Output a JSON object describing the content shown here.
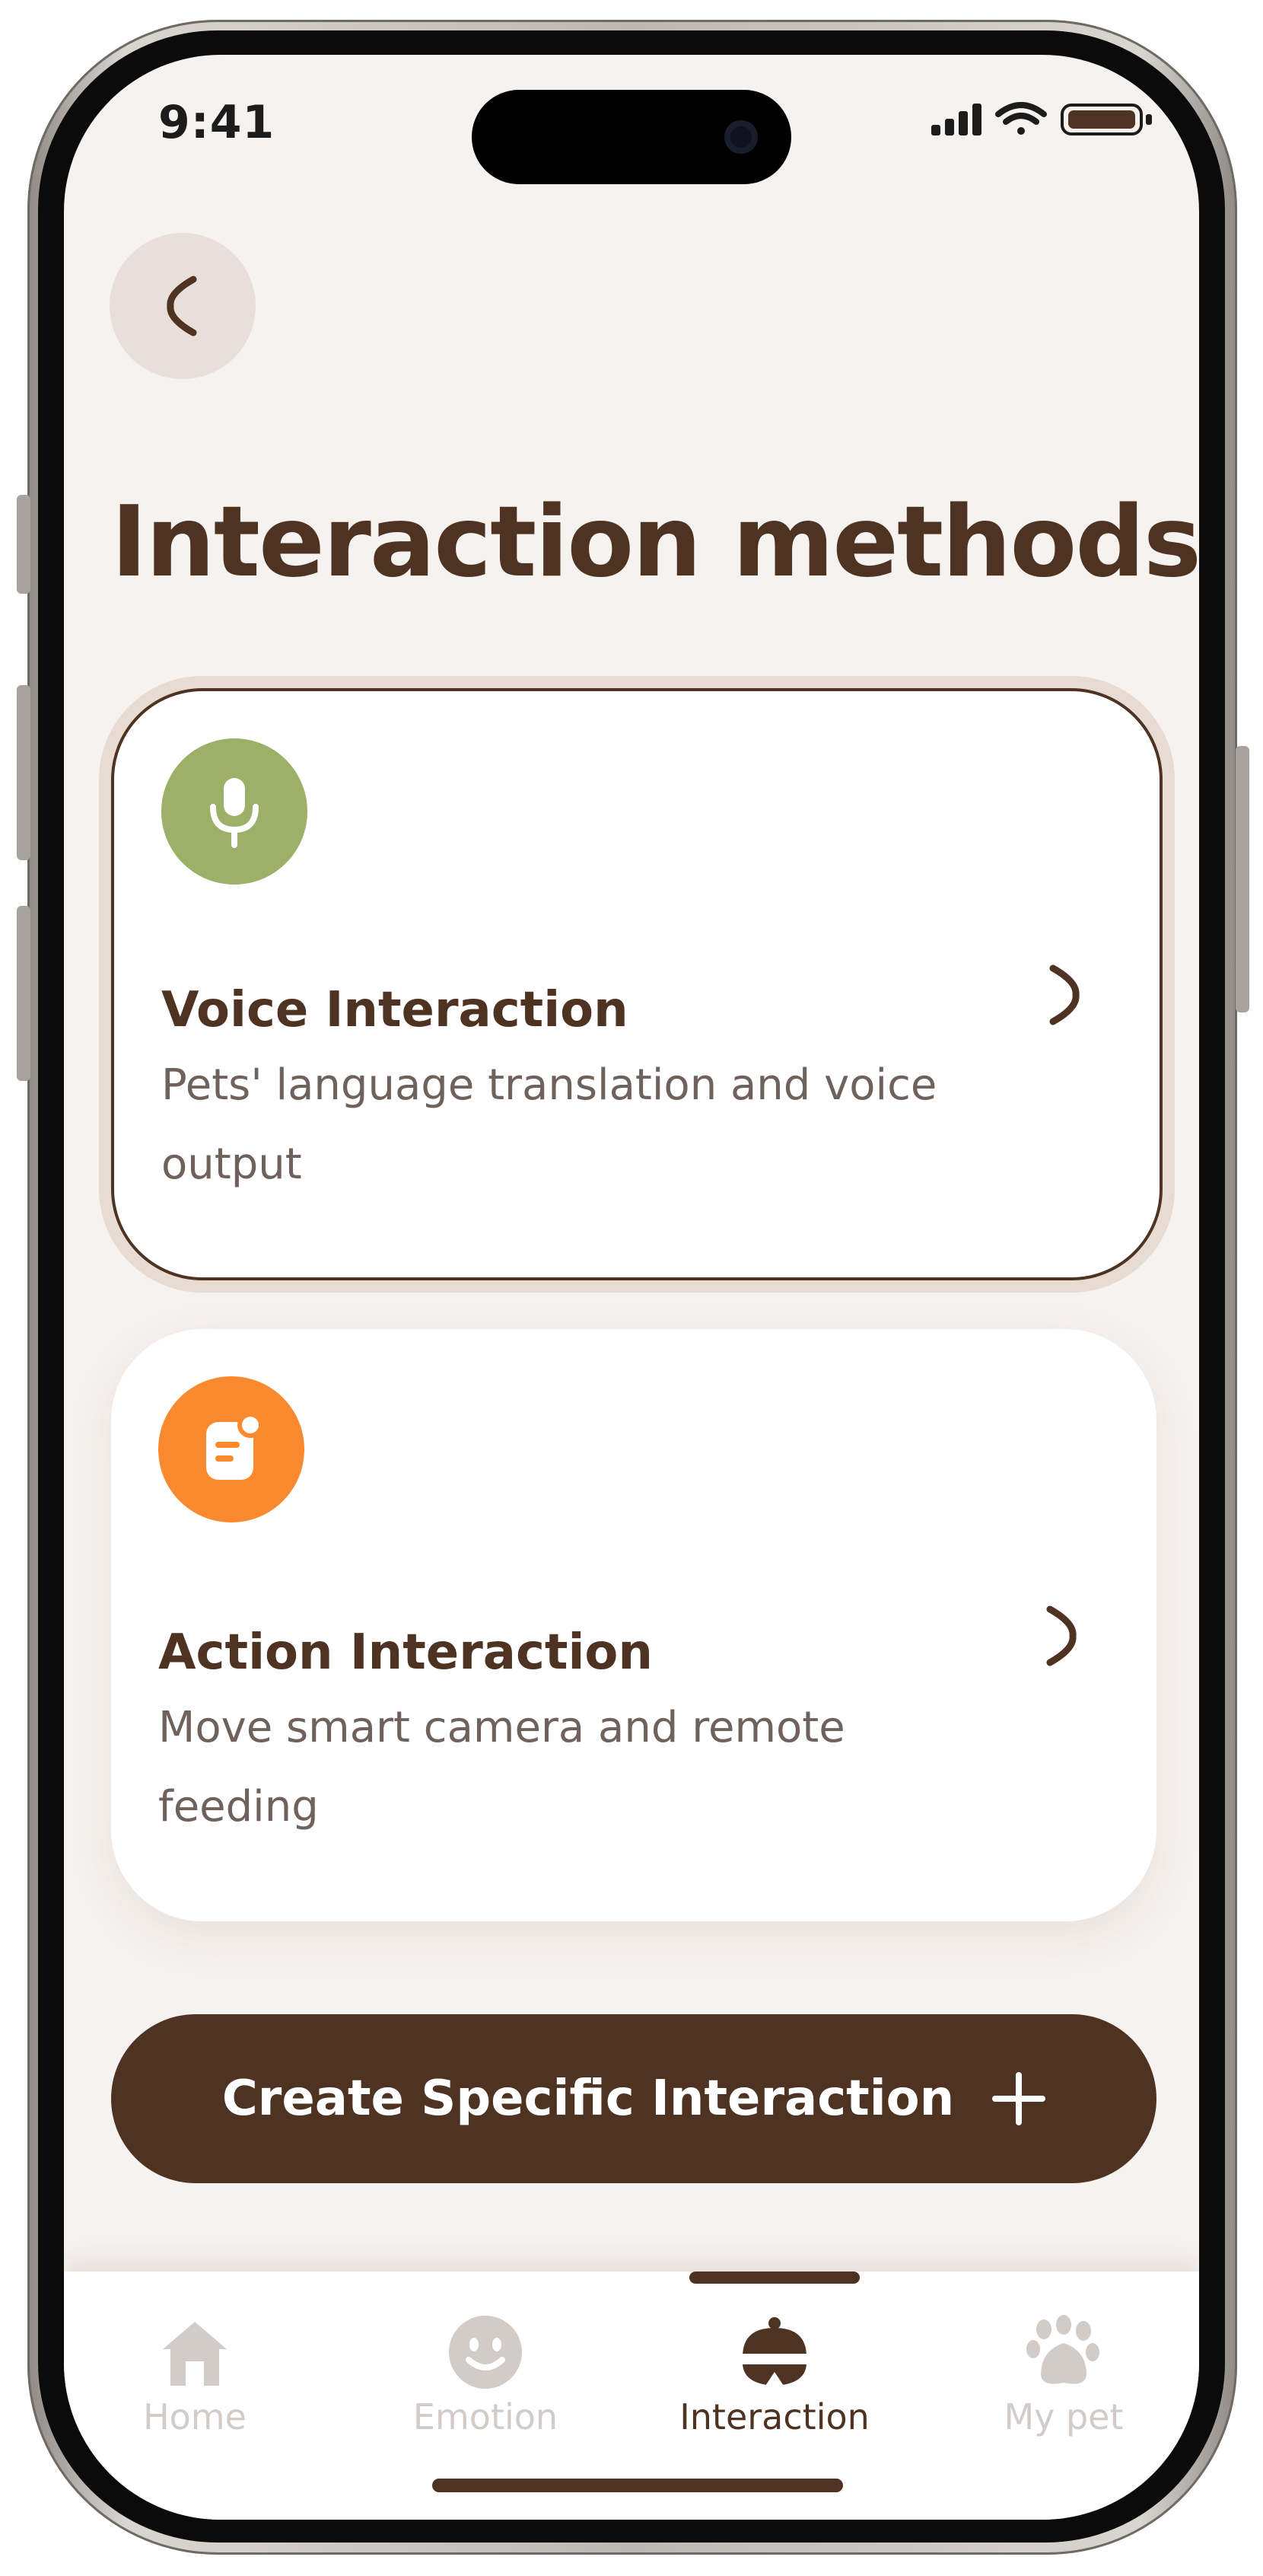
{
  "status_bar": {
    "time": "9:41"
  },
  "header": {
    "back_icon": "chevron-left-icon",
    "title": "Interaction methods"
  },
  "cards": [
    {
      "title": "Voice Interaction",
      "description": "Pets' language translation and voice output",
      "icon": "microphone-icon",
      "icon_color": "#9cb068",
      "selected": true
    },
    {
      "title": "Action Interaction",
      "description": "Move smart camera and remote feeding",
      "icon": "note-icon",
      "icon_color": "#fb8a2e",
      "selected": false
    }
  ],
  "create_button": {
    "label": "Create Specific Interaction",
    "icon": "plus-icon"
  },
  "tabbar": {
    "items": [
      {
        "label": "Home",
        "icon": "home-icon",
        "active": false
      },
      {
        "label": "Emotion",
        "icon": "smiley-icon",
        "active": false
      },
      {
        "label": "Interaction",
        "icon": "bell-icon",
        "active": true
      },
      {
        "label": "My pet",
        "icon": "paw-icon",
        "active": false
      }
    ]
  },
  "colors": {
    "primary_brown": "#4e3322",
    "background": "#f6f2ef",
    "inactive_tab": "#d2cbc8",
    "voice_green": "#9cb068",
    "action_orange": "#fb8a2e"
  }
}
